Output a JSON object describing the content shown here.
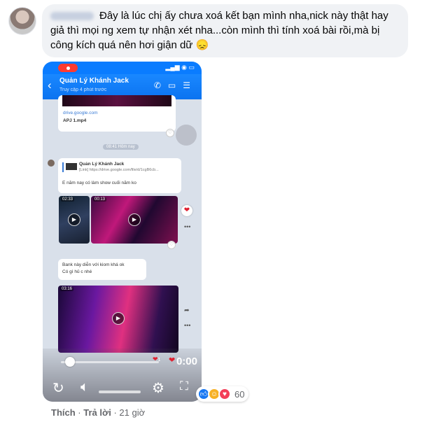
{
  "comment": {
    "text": "Đây là lúc chị ấy chưa xoá kết bạn mình nha,nick này thật hay giả thì mọi ng xem tự nhận xét nha...còn mình thì tính xoá bài rồi,mà bị công kích quá nên hơi giận dữ 😞"
  },
  "screenshot": {
    "contact_name": "Quản Lý Khánh Jack",
    "contact_status": "Truy cập 4 phút trước",
    "link1_domain": "drive.google.com",
    "link1_file": "APJ 1.mp4",
    "time_divider": "08:41 Hôm nay",
    "quote_name": "Quản Lý Khánh Jack",
    "quote_link": "[Link] https://drive.google.com/file/d/1cgB6cb...",
    "msg1": "E năm nay có làm show cuối năm ko",
    "video1_duration": "02:33",
    "video2_duration": "00:13",
    "msg2_line1": "Bank này diễn với kiom khá ok",
    "msg2_line2": "Có gì hủ c nhé",
    "video3_duration": "03:16",
    "video_time": "0:00",
    "small_heart_count": "1"
  },
  "reactions": {
    "count": "60",
    "icons": [
      "like-icon",
      "care-icon",
      "love-icon"
    ]
  },
  "actions": {
    "like": "Thích",
    "sep1": " · ",
    "reply": "Trả lời",
    "sep2": " · ",
    "time": "21 giờ"
  }
}
